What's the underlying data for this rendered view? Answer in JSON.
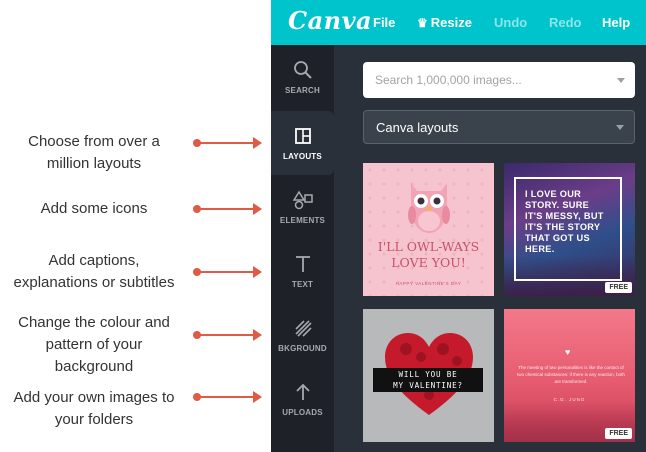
{
  "annotations": {
    "layouts": [
      "Choose from over a",
      "million layouts"
    ],
    "icons": [
      "Add some icons"
    ],
    "text": [
      "Add captions,",
      "explanations or subtitles"
    ],
    "background": [
      "Change the colour and",
      "pattern of your",
      "background"
    ],
    "uploads": [
      "Add your own images to",
      "your folders"
    ]
  },
  "topbar": {
    "logo": "Canva",
    "menu_file": "File",
    "menu_resize": "Resize",
    "menu_undo": "Undo",
    "menu_redo": "Redo",
    "menu_help": "Help"
  },
  "sidebar": {
    "items": [
      {
        "label": "SEARCH",
        "icon": "search-icon"
      },
      {
        "label": "LAYOUTS",
        "icon": "layouts-icon"
      },
      {
        "label": "ELEMENTS",
        "icon": "elements-icon"
      },
      {
        "label": "TEXT",
        "icon": "text-icon"
      },
      {
        "label": "BKGROUND",
        "icon": "background-icon"
      },
      {
        "label": "UPLOADS",
        "icon": "upload-icon"
      }
    ]
  },
  "search": {
    "placeholder": "Search 1,000,000 images..."
  },
  "layout_select": {
    "value": "Canva layouts"
  },
  "thumbnails": {
    "t1": {
      "quote_1": "I'LL OWL-WAYS",
      "quote_2": "LOVE YOU!",
      "small": "HAPPY VALENTINE'S DAY"
    },
    "t2": {
      "lines": [
        "I LOVE OUR",
        "STORY. SURE",
        "IT'S MESSY, BUT",
        "IT'S THE STORY",
        "THAT GOT US",
        "HERE."
      ],
      "badge": "FREE"
    },
    "t3": {
      "line_1": "WILL YOU BE",
      "line_2": "MY VALENTINE?"
    },
    "t4": {
      "quote": "The meeting of two personalities is like the contact of two chemical substances: if there is any reaction, both are transformed.",
      "author": "C.G. JUNG",
      "badge": "FREE"
    }
  },
  "colors": {
    "brand": "#00c4cc",
    "arrow": "#e05a44",
    "panel": "#293039",
    "sidebar": "#1e2228"
  }
}
